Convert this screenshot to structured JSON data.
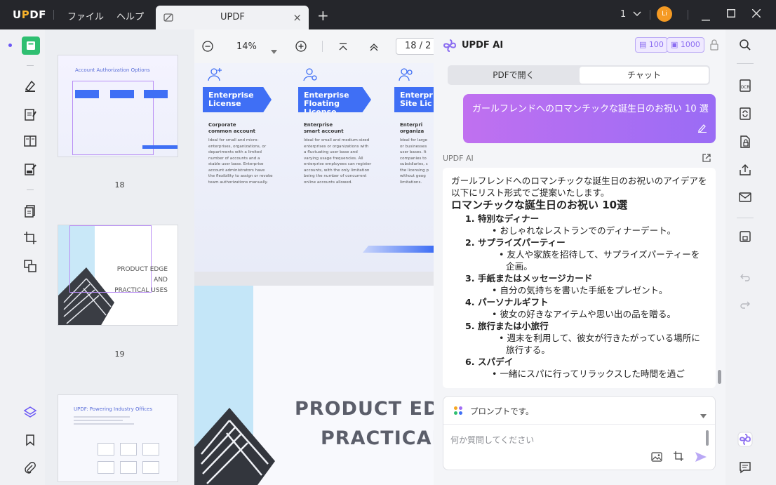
{
  "app": {
    "logo": "UPDF",
    "menu": [
      "ファイル",
      "ヘルプ"
    ],
    "tab_title": "UPDF",
    "tab_close": "×",
    "new_tab": "+",
    "page_selector": "1",
    "avatar_initials": "Li",
    "colors": {
      "accent_green": "#2fbf71",
      "accent_blue": "#3f6ff5",
      "accent_purple": "#8b6df1",
      "titlebar": "#25262b"
    }
  },
  "viewer": {
    "zoom": "14%",
    "current_page": "18 / 2",
    "thumbnails": [
      {
        "page": "18",
        "title": "Account Authorization Options"
      },
      {
        "page": "19",
        "title_line1": "PRODUCT EDGE AND",
        "title_line2": "PRACTICAL USES"
      },
      {
        "title": "UPDF: Powering Industry Offices"
      }
    ],
    "page1_cards": [
      {
        "title_line1": "Enterprise",
        "title_line2": "License",
        "sub1": "Corporate",
        "sub2": "common account",
        "body": [
          "Ideal for small and micro-",
          "enterprises, organizations, or",
          "departments with a limited",
          "number of accounts and a",
          "stable user base. Enterprise",
          "account administrators have",
          "the flexibility to assign or revoke",
          "team authorizations manually."
        ]
      },
      {
        "title_line1": "Enterprise",
        "title_line2": "Floating License",
        "sub1": "Enterprise",
        "sub2": "smart account",
        "body": [
          "Ideal for small and medium-sized",
          "enterprises or organizations with",
          "a fluctuating user base and",
          "varying usage frequencies. All",
          "enterprise employees can register",
          "accounts, with the only limitation",
          "being the number of concurrent",
          "online accounts allowed."
        ]
      },
      {
        "title_line1": "Enterpr",
        "title_line2": "Site Lic",
        "sub1": "Enterpri",
        "sub2": "organiza",
        "body": [
          "Ideal for large",
          "or businesses",
          "user bases. It",
          "companies to",
          "subsidiaries, c",
          "the licensing p",
          "without geog",
          "limitations."
        ]
      }
    ],
    "page2_title_line1": "PRODUCT EDGE",
    "page2_title_line2": "PRACTICAL U"
  },
  "ai": {
    "title": "UPDF AI",
    "credit_1": "100",
    "credit_2": "1000",
    "tabs": [
      "PDFで開く",
      "チャット"
    ],
    "user_message": "ガールフレンドへのロマンチックな誕生日のお祝い 10 選",
    "answer_label": "UPDF AI",
    "answer_intro": "ガールフレンドへのロマンチックな誕生日のお祝いのアイデアを以下にリスト形式でご提案いたします。",
    "answer_heading": "ロマンチックな誕生日のお祝い 10選",
    "answer_items": [
      {
        "num": "1.",
        "title": "特別なディナー",
        "detail": "おしゃれなレストランでのディナーデート。"
      },
      {
        "num": "2.",
        "title": "サプライズパーティー",
        "detail": "友人や家族を招待して、サプライズパーティーを企画。"
      },
      {
        "num": "3.",
        "title": "手紙またはメッセージカード",
        "detail": "自分の気持ちを書いた手紙をプレゼント。"
      },
      {
        "num": "4.",
        "title": "パーソナルギフト",
        "detail": "彼女の好きなアイテムや思い出の品を贈る。"
      },
      {
        "num": "5.",
        "title": "旅行または小旅行",
        "detail": "週末を利用して、彼女が行きたがっている場所に旅行する。"
      },
      {
        "num": "6.",
        "title": "スパデイ",
        "detail": "一緒にスパに行ってリラックスした時間を過ご"
      }
    ],
    "prompt_label": "プロンプトです。",
    "input_placeholder": "何か質問してください"
  }
}
